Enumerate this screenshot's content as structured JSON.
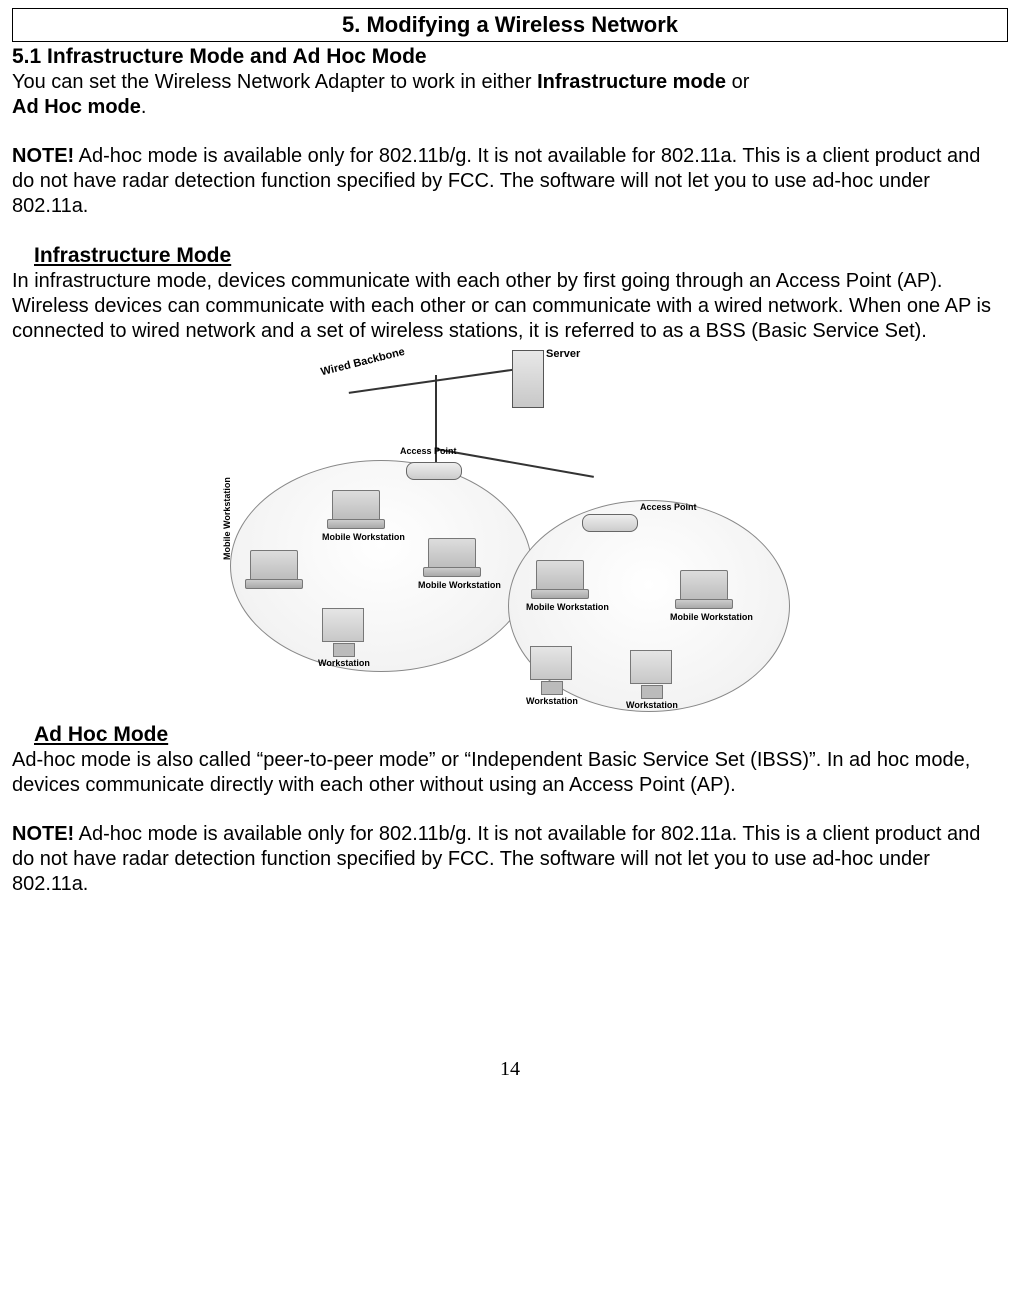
{
  "header": {
    "title": "5. Modifying a Wireless Network"
  },
  "section": {
    "heading": "5.1 Infrastructure Mode and Ad Hoc Mode",
    "intro_a": "You can set the Wireless Network Adapter to work in either ",
    "intro_b": "Infrastructure mode",
    "intro_c": " or",
    "intro_d": "Ad Hoc mode",
    "intro_e": ".",
    "note_label": "NOTE!",
    "note_body": " Ad-hoc mode is available only for 802.11b/g.  It is not available for 802.11a.  This is a client product and do not have radar detection function specified by FCC.  The software will not let you to use ad-hoc under 802.11a."
  },
  "infra": {
    "title": "Infrastructure Mode",
    "body": "In infrastructure mode, devices communicate with each other by first going through an Access Point (AP).  Wireless devices can communicate with each other or can communicate with a wired network.  When one AP is connected to wired network and a set of wireless stations, it is referred to as a BSS (Basic Service Set)."
  },
  "diagram": {
    "wired_backbone": "Wired Backbone",
    "server": "Server",
    "access_point": "Access Point",
    "mobile_workstation": "Mobile Workstation",
    "workstation": "Workstation"
  },
  "adhoc": {
    "title": "Ad Hoc Mode",
    "body": "Ad-hoc mode is also called “peer-to-peer mode” or “Independent Basic Service Set (IBSS)”.  In ad hoc mode, devices communicate directly with each other without using an Access Point (AP).",
    "note_label": "NOTE!",
    "note_body": " Ad-hoc mode is available only for 802.11b/g.  It is not available for 802.11a.  This is a client product and do not have radar detection function specified by FCC.  The software will not let you to use ad-hoc under 802.11a."
  },
  "page_number": "14"
}
